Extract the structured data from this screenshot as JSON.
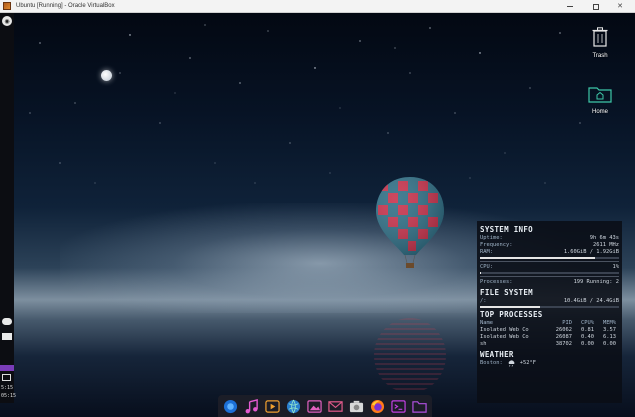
{
  "window": {
    "title": "Ubuntu [Running] - Oracle VirtualBox",
    "close_glyph": "✕"
  },
  "left_panel": {
    "top_icon": "ubuntu-logo-icon",
    "cloud_icon": "cloud-icon",
    "mail_icon": "mail-icon",
    "num_top": "5:15",
    "num_bottom": "05:15"
  },
  "desktop_icons": [
    {
      "label": "Trash",
      "icon": "trash-icon"
    },
    {
      "label": "Home",
      "icon": "home-folder-icon"
    }
  ],
  "colors": {
    "accent": "#7a3cb8",
    "home_folder": "#3ec7a8",
    "balloon_red": "#c8324c",
    "balloon_teal": "#2f6f86"
  },
  "conky": {
    "system_info": {
      "title": "SYSTEM INFO",
      "uptime_label": "Uptime:",
      "uptime_value": "9h 6m 43s",
      "frequency_label": "Frequency:",
      "frequency_value": "2611 MHz",
      "ram_label": "RAM:",
      "ram_value": "1.60GiB / 1.92GiB",
      "ram_fraction": 0.83,
      "cpu_label": "CPU:",
      "cpu_value": "1%",
      "cpu_fraction": 0.01,
      "processes_label": "Processes:",
      "processes_value": "199 Running: 2"
    },
    "file_system": {
      "title": "FILE SYSTEM",
      "mount": "/:",
      "usage": "10.4GiB / 24.4GiB",
      "usage_fraction": 0.43
    },
    "top_processes": {
      "title": "TOP PROCESSES",
      "headers": [
        "Name",
        "PID",
        "CPU%",
        "MEM%"
      ],
      "rows": [
        [
          "Isolated Web Co",
          "26062",
          "0.81",
          "3.57"
        ],
        [
          "Isolated Web Co",
          "26087",
          "0.40",
          "6.13"
        ],
        [
          "sh",
          "38702",
          "0.00",
          "0.00"
        ]
      ]
    },
    "weather": {
      "title": "WEATHER",
      "location": "Boston:",
      "icon": "cloud-rain-icon",
      "temp": "+52°F"
    }
  },
  "dock": [
    {
      "icon": "browser-blue-icon"
    },
    {
      "icon": "music-icon"
    },
    {
      "icon": "media-player-icon"
    },
    {
      "icon": "globe-icon"
    },
    {
      "icon": "image-viewer-icon"
    },
    {
      "icon": "mail-app-icon"
    },
    {
      "icon": "screenshot-icon"
    },
    {
      "icon": "firefox-icon"
    },
    {
      "icon": "terminal-icon"
    },
    {
      "icon": "files-icon"
    }
  ]
}
